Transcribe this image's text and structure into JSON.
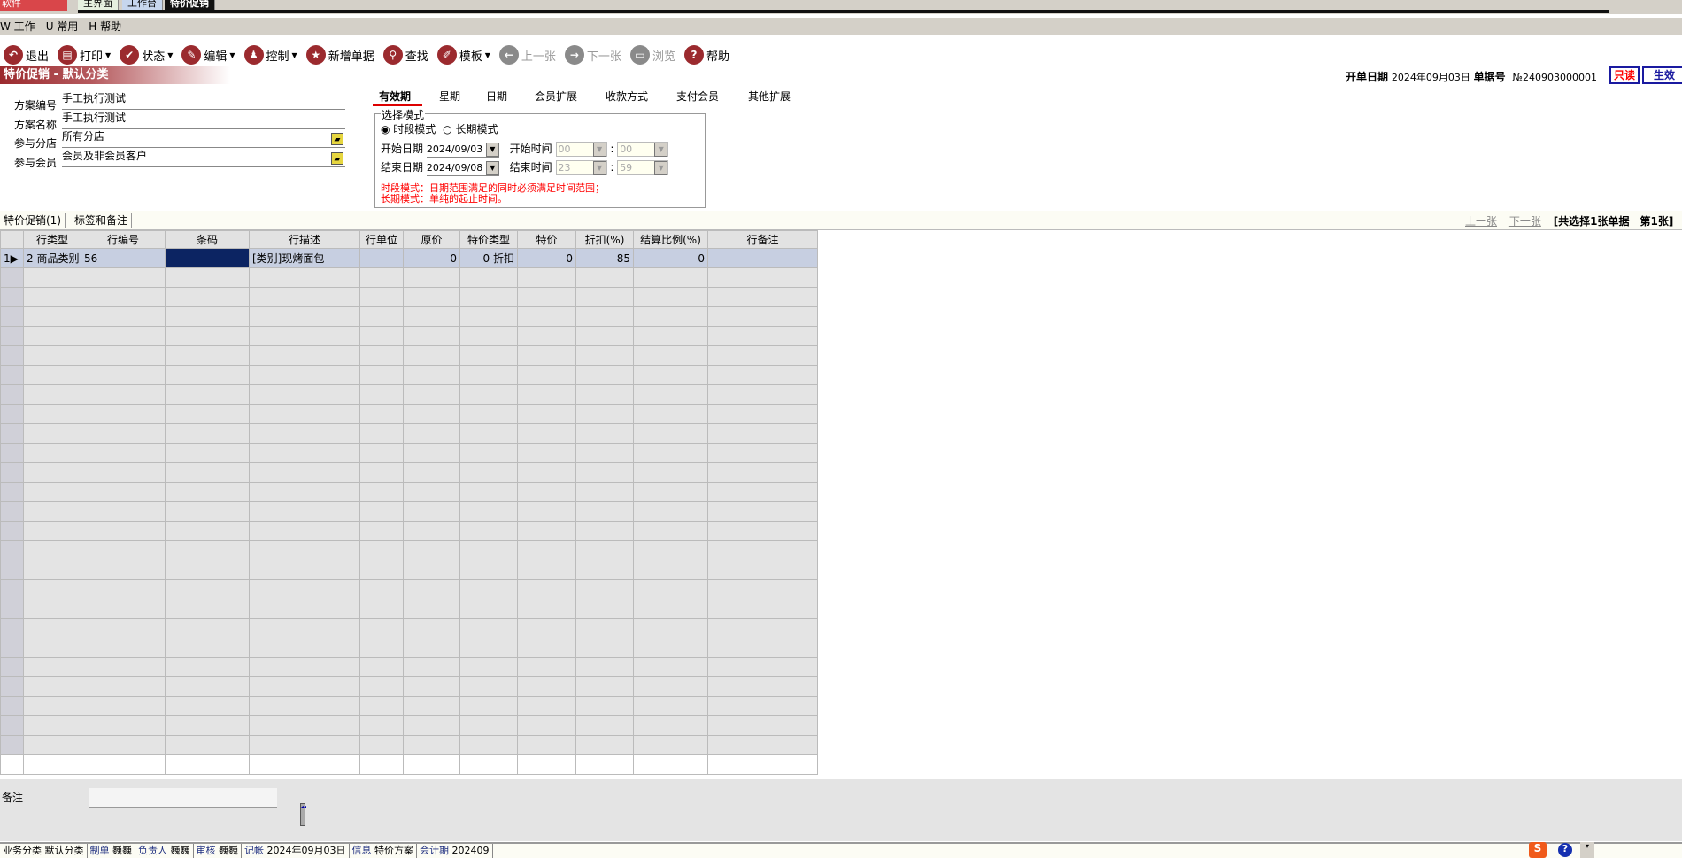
{
  "app": {
    "button": "软件",
    "tabs": [
      "主界面",
      "工作台",
      "特价促销"
    ]
  },
  "menu": [
    "W 工作",
    "U 常用",
    "H 帮助"
  ],
  "toolbar": [
    {
      "label": "退出",
      "icon": "undo-icon",
      "glyph": "↶",
      "dd": false,
      "dis": false
    },
    {
      "label": "打印",
      "icon": "printer-icon",
      "glyph": "▤",
      "dd": true,
      "dis": false
    },
    {
      "label": "状态",
      "icon": "check-icon",
      "glyph": "✔",
      "dd": true,
      "dis": false
    },
    {
      "label": "编辑",
      "icon": "pencil-icon",
      "glyph": "✎",
      "dd": true,
      "dis": false
    },
    {
      "label": "控制",
      "icon": "user-icon",
      "glyph": "♟",
      "dd": true,
      "dis": false
    },
    {
      "label": "新增单据",
      "icon": "star-icon",
      "glyph": "★",
      "dd": false,
      "dis": false
    },
    {
      "label": "查找",
      "icon": "search-icon",
      "glyph": "⚲",
      "dd": false,
      "dis": false
    },
    {
      "label": "模板",
      "icon": "eraser-icon",
      "glyph": "✐",
      "dd": true,
      "dis": false
    },
    {
      "label": "上一张",
      "icon": "arrow-left-icon",
      "glyph": "←",
      "dd": false,
      "dis": true
    },
    {
      "label": "下一张",
      "icon": "arrow-right-icon",
      "glyph": "→",
      "dd": false,
      "dis": true
    },
    {
      "label": "浏览",
      "icon": "folder-icon",
      "glyph": "▭",
      "dd": false,
      "dis": true
    },
    {
      "label": "帮助",
      "icon": "help-icon",
      "glyph": "?",
      "dd": false,
      "dis": false
    }
  ],
  "title": "特价促销 - 默认分类",
  "header": {
    "date_label": "开单日期",
    "date": "2024年09月03日",
    "no_label": "单据号",
    "no": "№240903000001",
    "readonly": "只读",
    "effective": "生效"
  },
  "form": [
    {
      "label": "方案编号",
      "value": "手工执行测试"
    },
    {
      "label": "方案名称",
      "value": "手工执行测试"
    },
    {
      "label": "参与分店",
      "value": "所有分店"
    },
    {
      "label": "参与会员",
      "value": "会员及非会员客户"
    }
  ],
  "tabs": [
    "有效期",
    "星期",
    "日期",
    "会员扩展",
    "收款方式",
    "支付会员",
    "其他扩展"
  ],
  "validity": {
    "group": "选择模式",
    "mode1": "时段模式",
    "mode2": "长期模式",
    "start_date_label": "开始日期",
    "start_date": "2024/09/03",
    "start_time_label": "开始时间",
    "start_h": "00",
    "start_m": "00",
    "end_date_label": "结束日期",
    "end_date": "2024/09/08",
    "end_time_label": "结束时间",
    "end_h": "23",
    "end_m": "59",
    "note1": "时段模式：日期范围满足的同时必须满足时间范围；",
    "note2": "长期模式：单纯的起止时间。"
  },
  "bottom_tabs": [
    "特价促销(1)",
    "标签和备注"
  ],
  "pager": {
    "prev": "上一张",
    "next": "下一张",
    "summary": "[共选择1张单据　第1张]"
  },
  "grid": {
    "columns": [
      "行类型",
      "行编号",
      "条码",
      "行描述",
      "行单位",
      "原价",
      "特价类型",
      "特价",
      "折扣(%)",
      "结算比例(%)",
      "行备注"
    ],
    "rows": [
      {
        "n": "1",
        "cells": [
          "2 商品类别",
          "56",
          "",
          "[类别]现烤面包",
          "",
          "0",
          "0 折扣",
          "0",
          "85",
          "0",
          ""
        ]
      }
    ]
  },
  "remark_label": "备注",
  "status": [
    [
      "业务分类",
      "默认分类"
    ],
    [
      "制单",
      "巍巍"
    ],
    [
      "负责人",
      "巍巍"
    ],
    [
      "审核",
      "巍巍"
    ],
    [
      "记帐",
      "2024年09月03日"
    ],
    [
      "信息",
      "特价方案"
    ],
    [
      "会计期",
      "202409"
    ]
  ]
}
